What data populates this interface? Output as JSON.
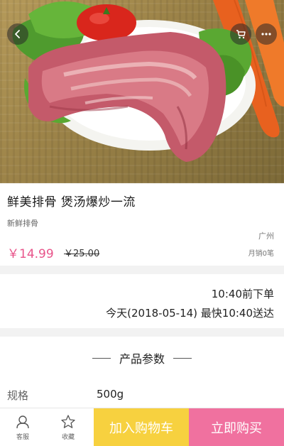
{
  "product": {
    "title": "鲜美排骨 煲汤爆炒一流",
    "subtitle": "新鲜排骨",
    "price": "￥14.99",
    "original_price": "￥25.00",
    "location": "广州",
    "sales": "月销0笔"
  },
  "delivery": {
    "deadline": "10:40前下单",
    "delivery_time": "今天(2018-05-14)  最快10:40送达"
  },
  "params": {
    "title": "产品参数",
    "specs": [
      {
        "label": "规格",
        "value": "500g"
      }
    ]
  },
  "bottom_bar": {
    "service_label": "客服",
    "favorite_label": "收藏",
    "add_to_cart": "加入购物车",
    "buy_now": "立即购买"
  },
  "colors": {
    "price": "#e8548a",
    "add_to_cart_bg": "#f7d13f",
    "buy_now_bg": "#f0719f"
  },
  "icons": {
    "back": "back-arrow-icon",
    "cart": "cart-icon",
    "more": "more-icon",
    "service": "headset-icon",
    "favorite": "star-icon"
  }
}
